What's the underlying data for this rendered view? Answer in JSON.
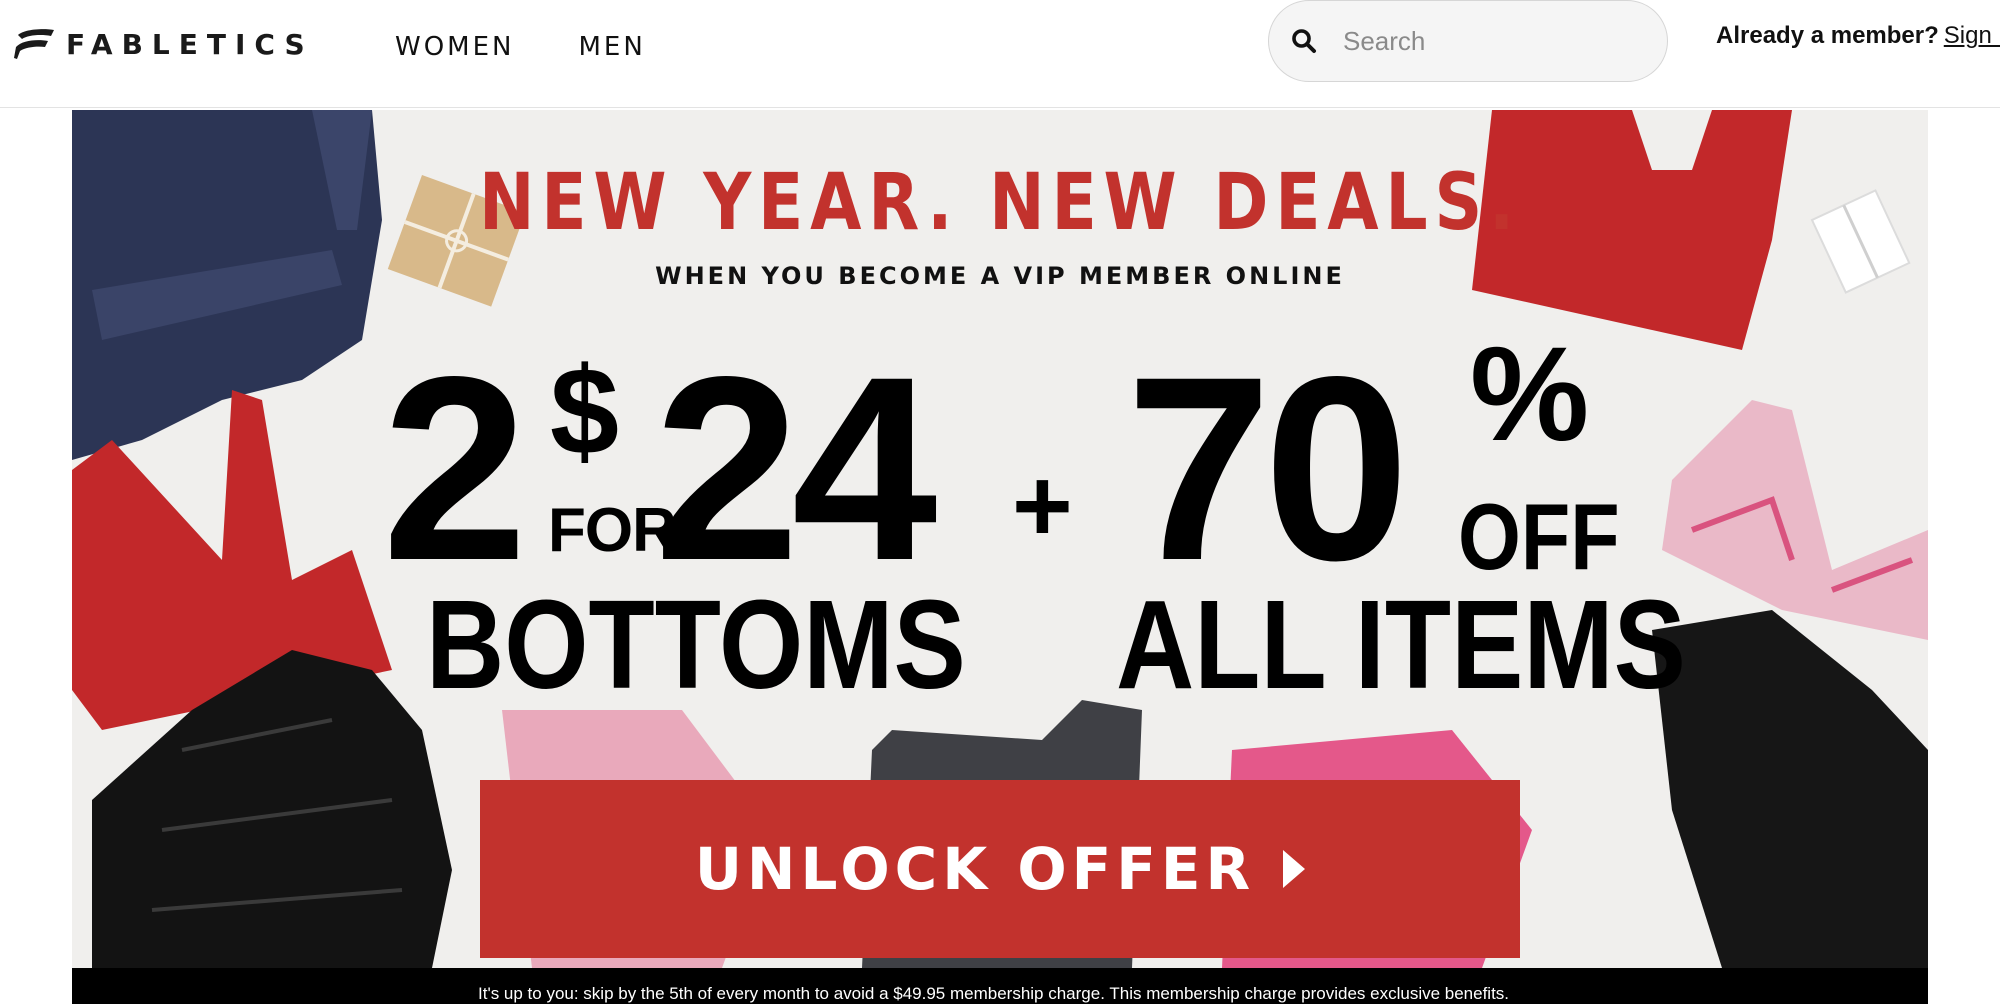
{
  "brand": {
    "name": "FABLETICS",
    "accent": "#c2322d"
  },
  "nav": {
    "items": [
      {
        "label": "WOMEN"
      },
      {
        "label": "MEN"
      }
    ]
  },
  "search": {
    "placeholder": "Search",
    "value": "",
    "icon": "search-icon"
  },
  "account": {
    "prompt": "Already a member?",
    "signin_label": "Sign In"
  },
  "hero": {
    "headline": "NEW YEAR. NEW DEALS.",
    "subline": "WHEN YOU BECOME A VIP MEMBER ONLINE",
    "offer_left": {
      "quantity": "2",
      "currency": "$",
      "for_label": "FOR",
      "price": "24",
      "category": "BOTTOMS"
    },
    "plus": "+",
    "offer_right": {
      "amount": "70",
      "percent": "%",
      "off_label": "OFF",
      "category": "ALL ITEMS"
    },
    "cta_label": "UNLOCK OFFER"
  },
  "disclaimer": "It's up to you: skip by the 5th of every month to avoid a $49.95 membership charge. This membership charge provides exclusive benefits."
}
